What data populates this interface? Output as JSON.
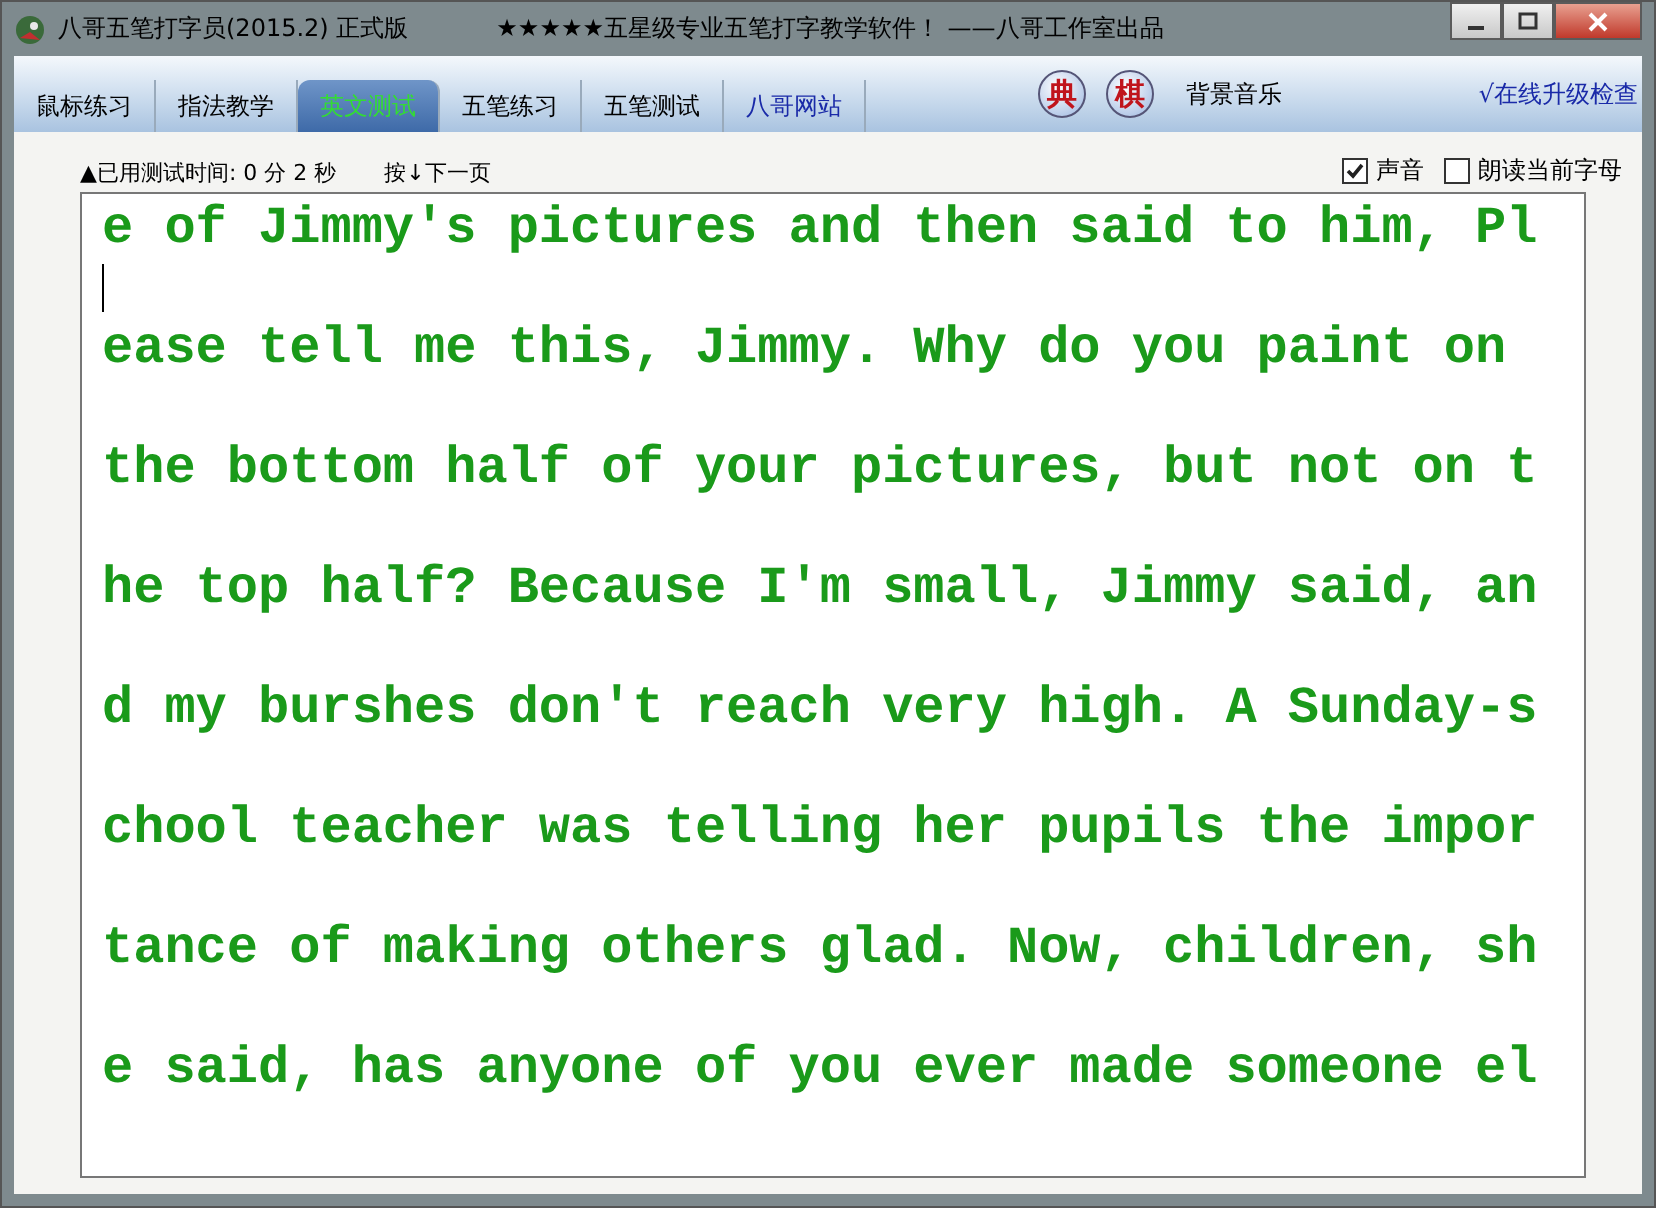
{
  "window": {
    "title": "八哥五笔打字员(2015.2) 正式版",
    "slogan": "★★★★★五星级专业五笔打字教学软件！ ——八哥工作室出品"
  },
  "tabs": [
    {
      "label": "鼠标练习",
      "selected": false
    },
    {
      "label": "指法教学",
      "selected": false
    },
    {
      "label": "英文测试",
      "selected": true
    },
    {
      "label": "五笔练习",
      "selected": false
    },
    {
      "label": "五笔测试",
      "selected": false
    },
    {
      "label": "八哥网站",
      "selected": false,
      "kind": "link"
    }
  ],
  "toolbar": {
    "dict_button": "典",
    "chess_button": "棋",
    "music": "背景音乐",
    "upgrade": "√在线升级检查"
  },
  "status": {
    "elapsed": "▲已用测试时间: 0 分  2 秒",
    "hint": "按↓下一页"
  },
  "options": [
    {
      "label": "声音",
      "checked": true
    },
    {
      "label": "朗读当前字母",
      "checked": false
    }
  ],
  "text_lines": [
    {
      "text": "e of Jimmy's pictures and then said to him, Pl",
      "cursor": true
    },
    {
      "text": "ease tell me this, Jimmy. Why do you paint on",
      "cursor": false
    },
    {
      "text": "the bottom half of your pictures, but not on t",
      "cursor": false
    },
    {
      "text": "he top half? Because I'm small, Jimmy said, an",
      "cursor": false
    },
    {
      "text": "d my burshes don't reach very high. A Sunday-s",
      "cursor": false
    },
    {
      "text": "chool teacher was telling her pupils the impor",
      "cursor": false
    },
    {
      "text": "tance of making others glad. Now, children, sh",
      "cursor": false
    },
    {
      "text": "e said, has anyone of you ever made someone el",
      "cursor": false
    }
  ]
}
